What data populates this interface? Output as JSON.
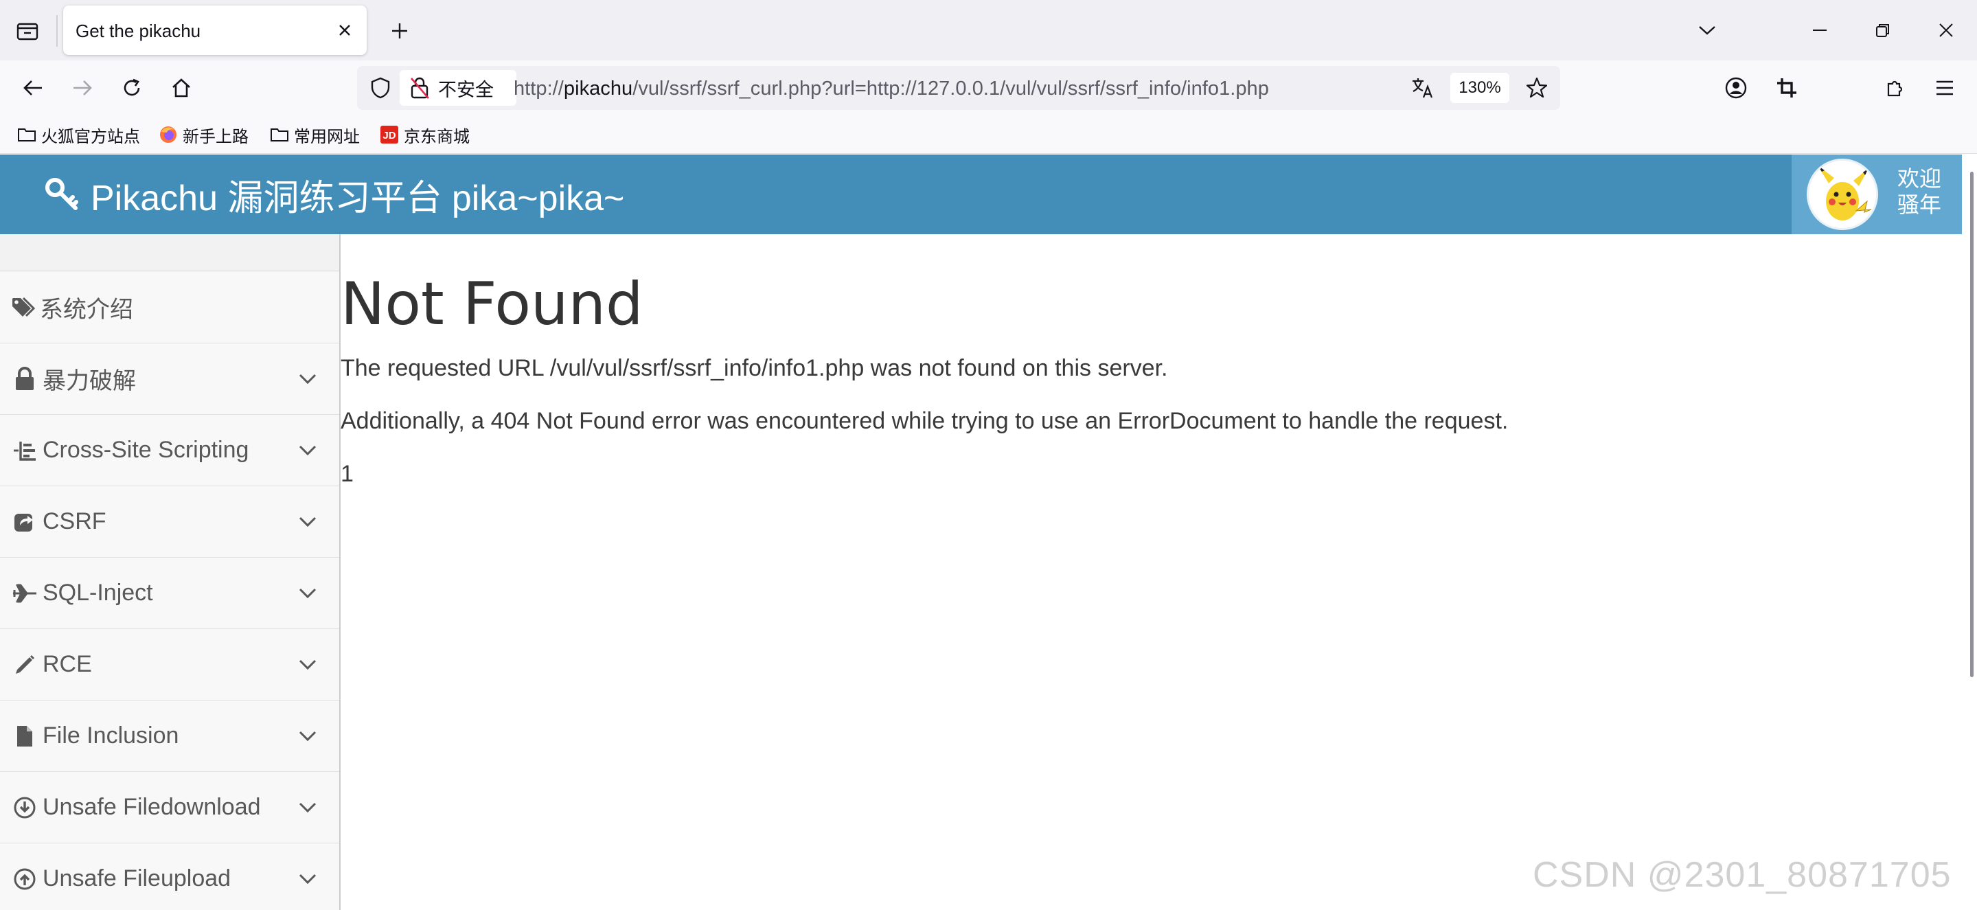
{
  "browser": {
    "tab_title": "Get the pikachu",
    "insecure_label": "不安全",
    "url_prefix": "http://",
    "url_host": "pikachu",
    "url_path": "/vul/ssrf/ssrf_curl.php?url=http://127.0.0.1/vul/vul/ssrf/ssrf_info/info1.php",
    "zoom": "130%",
    "bookmarks": [
      {
        "label": "火狐官方站点",
        "icon": "folder-icon"
      },
      {
        "label": "新手上路",
        "icon": "firefox-icon"
      },
      {
        "label": "常用网址",
        "icon": "folder-icon"
      },
      {
        "label": "京东商城",
        "icon": "jd-icon"
      }
    ]
  },
  "header": {
    "brand": "Pikachu 漏洞练习平台 pika~pika~",
    "welcome_line1": "欢迎",
    "welcome_line2": "骚年",
    "color": "#438eb9",
    "user_area_color": "#62a8d1"
  },
  "sidebar": {
    "items": [
      {
        "label": "系统介绍",
        "icon": "tags-icon",
        "expandable": false
      },
      {
        "label": "暴力破解",
        "icon": "lock-icon",
        "expandable": true
      },
      {
        "label": "Cross-Site Scripting",
        "icon": "xss-icon",
        "expandable": true
      },
      {
        "label": "CSRF",
        "icon": "share-icon",
        "expandable": true
      },
      {
        "label": "SQL-Inject",
        "icon": "plane-icon",
        "expandable": true
      },
      {
        "label": "RCE",
        "icon": "pencil-icon",
        "expandable": true
      },
      {
        "label": "File Inclusion",
        "icon": "file-icon",
        "expandable": true
      },
      {
        "label": "Unsafe Filedownload",
        "icon": "download-circle-icon",
        "expandable": true
      },
      {
        "label": "Unsafe Fileupload",
        "icon": "upload-circle-icon",
        "expandable": true
      }
    ]
  },
  "content": {
    "title": "Not Found",
    "line1": "The requested URL /vul/vul/ssrf/ssrf_info/info1.php was not found on this server.",
    "line2": "Additionally, a 404 Not Found error was encountered while trying to use an ErrorDocument to handle the request.",
    "line3": "1"
  },
  "watermark": "CSDN @2301_80871705"
}
